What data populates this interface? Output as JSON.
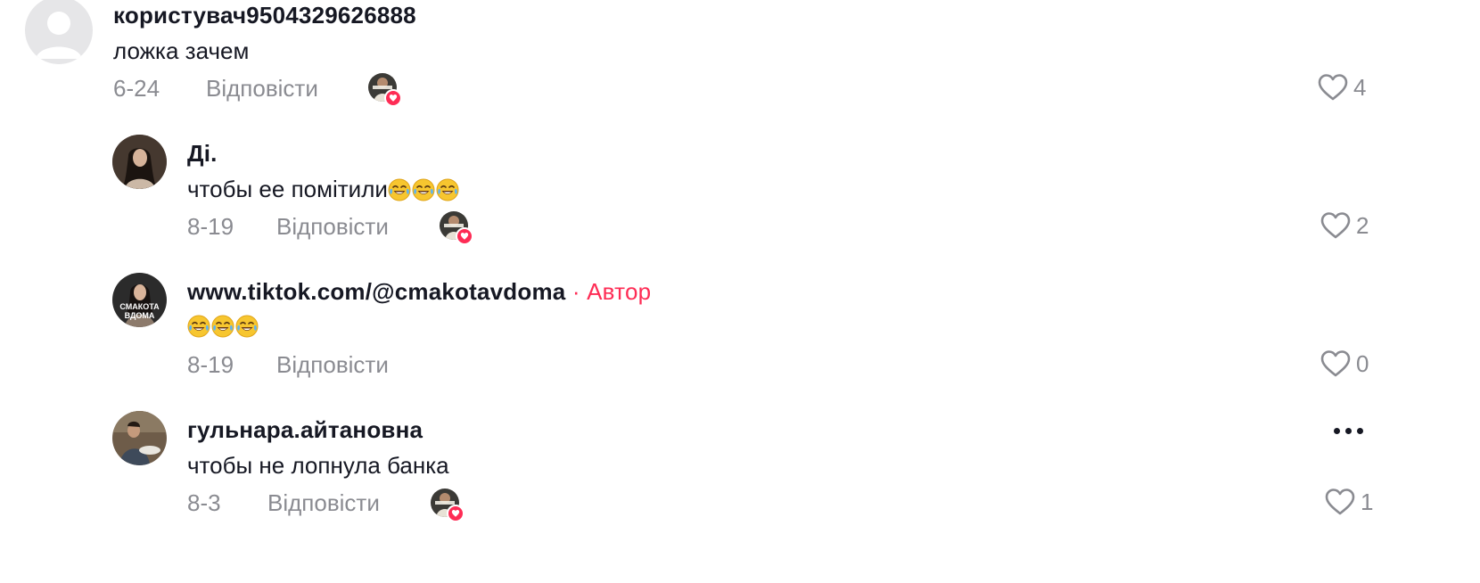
{
  "comments": [
    {
      "username": "користувач9504329626888",
      "text": "ложка зачем",
      "date": "6-24",
      "reply_label": "Відповісти",
      "likes": "4",
      "liked_by_creator": true
    },
    {
      "username": "Ді.",
      "text": "чтобы ее помітили",
      "emoji": "😂😂😂",
      "date": "8-19",
      "reply_label": "Відповісти",
      "likes": "2",
      "liked_by_creator": true
    },
    {
      "username": "www.tiktok.com/@cmakotavdoma",
      "author_tag": " · Автор",
      "text": "",
      "emoji": "😂😂😂",
      "date": "8-19",
      "reply_label": "Відповісти",
      "likes": "0",
      "avatar_text_line1": "СМАКОТА",
      "avatar_text_line2": "ВДОМА"
    },
    {
      "username": "гульнара.айтановна",
      "text": "чтобы не лопнула банка",
      "date": "8-3",
      "reply_label": "Відповісти",
      "likes": "1",
      "liked_by_creator": true
    }
  ],
  "colors": {
    "accent": "#fe2c55",
    "meta": "#8a8b91",
    "text": "#161823"
  }
}
